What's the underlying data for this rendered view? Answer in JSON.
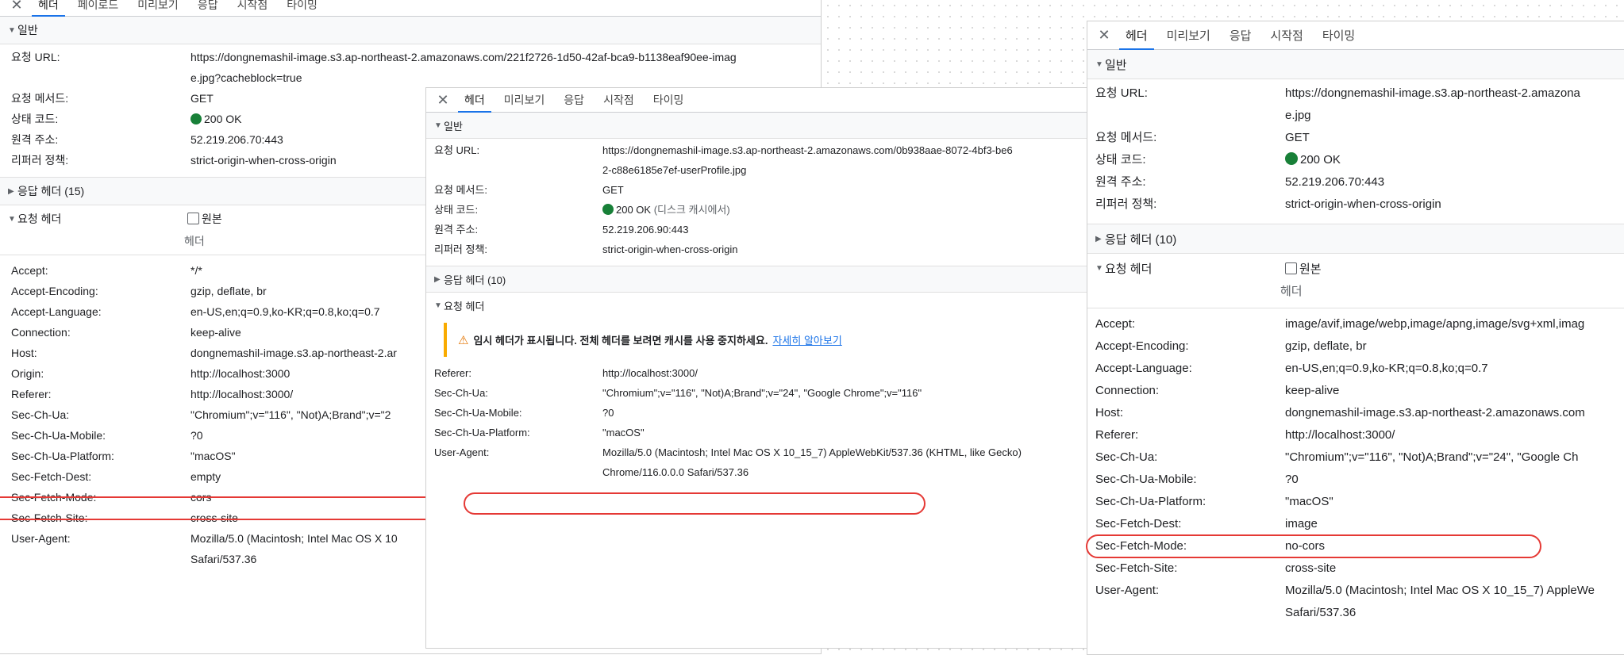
{
  "left": {
    "tabs": [
      "헤더",
      "페이로드",
      "미리보기",
      "응답",
      "시작점",
      "타이밍"
    ],
    "general_title": "일반",
    "general": [
      {
        "k": "요청 URL:",
        "v": "https://dongnemashil-image.s3.ap-northeast-2.amazonaws.com/221f2726-1d50-42af-bca9-b1138eaf90ee-imag\ne.jpg?cacheblock=true"
      },
      {
        "k": "요청 메서드:",
        "v": "GET"
      },
      {
        "k": "상태 코드:",
        "v": "200 OK"
      },
      {
        "k": "원격 주소:",
        "v": "52.219.206.70:443"
      },
      {
        "k": "리퍼러 정책:",
        "v": "strict-origin-when-cross-origin"
      }
    ],
    "response_headers_title": "응답 헤더 (15)",
    "request_headers_title": "요청 헤더",
    "raw_label": "원본",
    "header_col": "헤더",
    "request_headers": [
      {
        "k": "Accept:",
        "v": "*/*"
      },
      {
        "k": "Accept-Encoding:",
        "v": "gzip, deflate, br"
      },
      {
        "k": "Accept-Language:",
        "v": "en-US,en;q=0.9,ko-KR;q=0.8,ko;q=0.7"
      },
      {
        "k": "Connection:",
        "v": "keep-alive"
      },
      {
        "k": "Host:",
        "v": "dongnemashil-image.s3.ap-northeast-2.ar"
      },
      {
        "k": "Origin:",
        "v": "http://localhost:3000"
      },
      {
        "k": "Referer:",
        "v": "http://localhost:3000/"
      },
      {
        "k": "Sec-Ch-Ua:",
        "v": "\"Chromium\";v=\"116\", \"Not)A;Brand\";v=\"2"
      },
      {
        "k": "Sec-Ch-Ua-Mobile:",
        "v": "?0"
      },
      {
        "k": "Sec-Ch-Ua-Platform:",
        "v": "\"macOS\""
      },
      {
        "k": "Sec-Fetch-Dest:",
        "v": "empty"
      },
      {
        "k": "Sec-Fetch-Mode:",
        "v": "cors"
      },
      {
        "k": "Sec-Fetch-Site:",
        "v": "cross-site"
      },
      {
        "k": "User-Agent:",
        "v": "Mozilla/5.0 (Macintosh; Intel Mac OS X 10\nSafari/537.36"
      }
    ]
  },
  "middle": {
    "tabs": [
      "헤더",
      "미리보기",
      "응답",
      "시작점",
      "타이밍"
    ],
    "general_title": "일반",
    "general": [
      {
        "k": "요청 URL:",
        "v": "https://dongnemashil-image.s3.ap-northeast-2.amazonaws.com/0b938aae-8072-4bf3-be6\n2-c88e6185e7ef-userProfile.jpg"
      },
      {
        "k": "요청 메서드:",
        "v": "GET"
      },
      {
        "k": "상태 코드:",
        "v": "200 OK",
        "extra": "(디스크 캐시에서)"
      },
      {
        "k": "원격 주소:",
        "v": "52.219.206.90:443"
      },
      {
        "k": "리퍼러 정책:",
        "v": "strict-origin-when-cross-origin"
      }
    ],
    "response_headers_title": "응답 헤더 (10)",
    "request_headers_title": "요청 헤더",
    "warning_text": "임시 헤더가 표시됩니다. 전체 헤더를 보려면 캐시를 사용 중지하세요.",
    "warning_link": "자세히 알아보기",
    "request_headers": [
      {
        "k": "Referer:",
        "v": "http://localhost:3000/"
      },
      {
        "k": "Sec-Ch-Ua:",
        "v": "\"Chromium\";v=\"116\", \"Not)A;Brand\";v=\"24\", \"Google Chrome\";v=\"116\""
      },
      {
        "k": "Sec-Ch-Ua-Mobile:",
        "v": "?0"
      },
      {
        "k": "Sec-Ch-Ua-Platform:",
        "v": "\"macOS\""
      },
      {
        "k": "User-Agent:",
        "v": "Mozilla/5.0 (Macintosh; Intel Mac OS X 10_15_7) AppleWebKit/537.36 (KHTML, like Gecko)\nChrome/116.0.0.0 Safari/537.36"
      }
    ]
  },
  "right": {
    "tabs": [
      "헤더",
      "미리보기",
      "응답",
      "시작점",
      "타이밍"
    ],
    "general_title": "일반",
    "general": [
      {
        "k": "요청 URL:",
        "v": "https://dongnemashil-image.s3.ap-northeast-2.amazona\ne.jpg"
      },
      {
        "k": "요청 메서드:",
        "v": "GET"
      },
      {
        "k": "상태 코드:",
        "v": "200 OK"
      },
      {
        "k": "원격 주소:",
        "v": "52.219.206.70:443"
      },
      {
        "k": "리퍼러 정책:",
        "v": "strict-origin-when-cross-origin"
      }
    ],
    "response_headers_title": "응답 헤더 (10)",
    "request_headers_title": "요청 헤더",
    "raw_label": "원본",
    "header_col": "헤더",
    "request_headers": [
      {
        "k": "Accept:",
        "v": "image/avif,image/webp,image/apng,image/svg+xml,imag"
      },
      {
        "k": "Accept-Encoding:",
        "v": "gzip, deflate, br"
      },
      {
        "k": "Accept-Language:",
        "v": "en-US,en;q=0.9,ko-KR;q=0.8,ko;q=0.7"
      },
      {
        "k": "Connection:",
        "v": "keep-alive"
      },
      {
        "k": "Host:",
        "v": "dongnemashil-image.s3.ap-northeast-2.amazonaws.com"
      },
      {
        "k": "Referer:",
        "v": "http://localhost:3000/"
      },
      {
        "k": "Sec-Ch-Ua:",
        "v": "\"Chromium\";v=\"116\", \"Not)A;Brand\";v=\"24\", \"Google Ch"
      },
      {
        "k": "Sec-Ch-Ua-Mobile:",
        "v": "?0"
      },
      {
        "k": "Sec-Ch-Ua-Platform:",
        "v": "\"macOS\""
      },
      {
        "k": "Sec-Fetch-Dest:",
        "v": "image"
      },
      {
        "k": "Sec-Fetch-Mode:",
        "v": "no-cors"
      },
      {
        "k": "Sec-Fetch-Site:",
        "v": "cross-site"
      },
      {
        "k": "User-Agent:",
        "v": "Mozilla/5.0 (Macintosh; Intel Mac OS X 10_15_7) AppleWe\nSafari/537.36"
      }
    ]
  },
  "colors": {
    "accent": "#1a73e8",
    "status_ok": "#188038",
    "highlight": "#e53935",
    "warning": "#f9ab00"
  }
}
